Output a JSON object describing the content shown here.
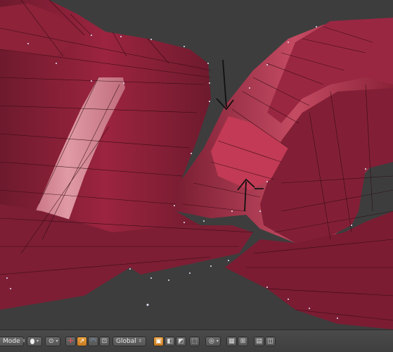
{
  "header": {
    "mode_label": "Mode",
    "orientation_label": "Global"
  },
  "icons": {
    "mode_dropdown_arrow": "up-down-arrow-icon",
    "shading": "viewport-shading-icon",
    "pivot": "pivot-point-icon",
    "manipulator": "manipulator-icon",
    "translate": "translate-icon",
    "rotate": "rotate-icon",
    "scale": "scale-icon",
    "snap_toggle": "snap-icon",
    "proportional": "proportional-edit-icon",
    "occlude": "occlude-geometry-icon",
    "render": "render-icon"
  },
  "colors": {
    "mesh_dark": "#7a1e33",
    "mesh_mid": "#a82a47",
    "mesh_light": "#d88a98",
    "background": "#3d3d3d",
    "active_button": "#e8a040"
  }
}
